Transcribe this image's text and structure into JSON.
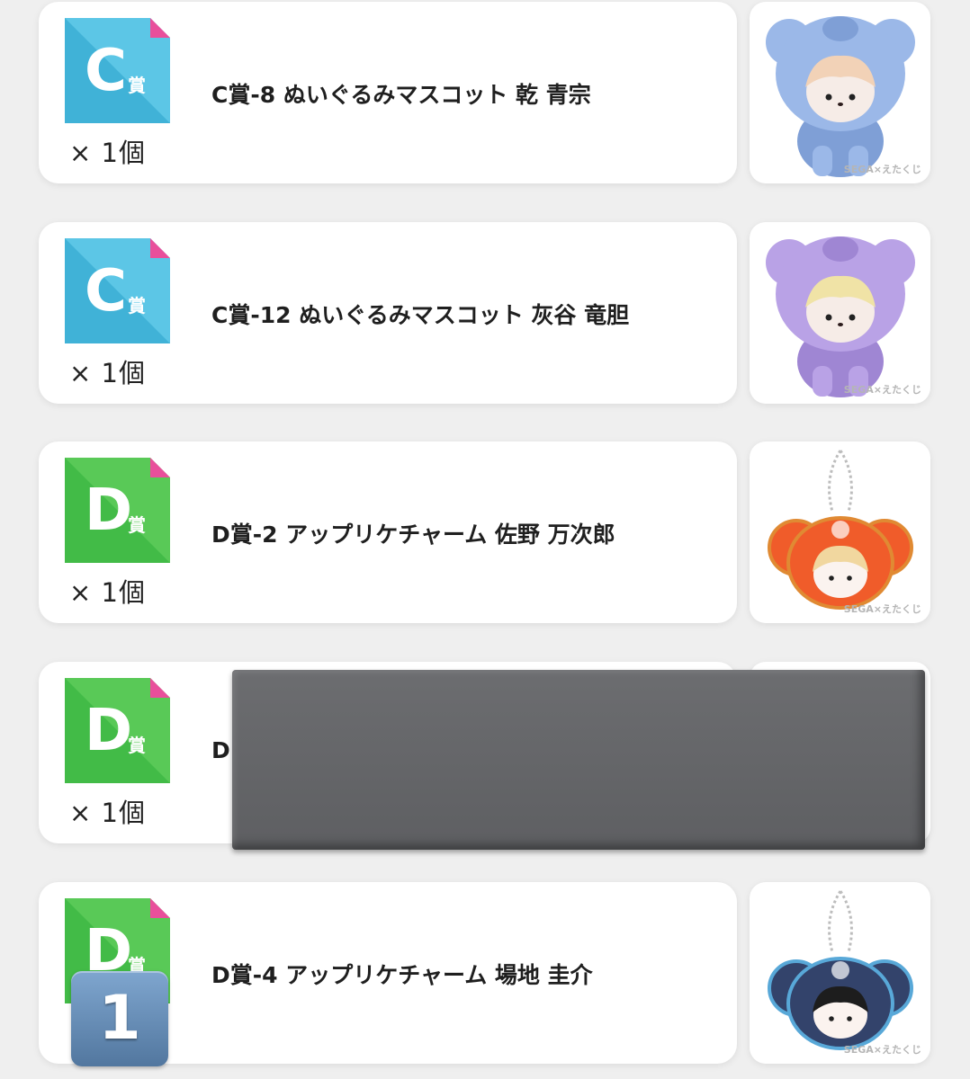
{
  "items": [
    {
      "grade_letter": "C",
      "grade_suffix": "賞",
      "grade_color": "#2aa3cb",
      "grade_color_light": "#5cc6e6",
      "name": "C賞-8 ぬいぐるみマスコット 乾 青宗",
      "quantity": "× 1個",
      "thumb_icon": "plush-mascot-blue-bear-icon",
      "watermark": "SEGA×えたくじ"
    },
    {
      "grade_letter": "C",
      "grade_suffix": "賞",
      "grade_color": "#2aa3cb",
      "grade_color_light": "#5cc6e6",
      "name": "C賞-12 ぬいぐるみマスコット 灰谷 竜胆",
      "quantity": "× 1個",
      "thumb_icon": "plush-mascot-purple-bear-icon",
      "watermark": "SEGA×えたくじ"
    },
    {
      "grade_letter": "D",
      "grade_suffix": "賞",
      "grade_color": "#2fae3a",
      "grade_color_light": "#59c957",
      "name": "D賞-2 アップリケチャーム 佐野 万次郎",
      "quantity": "× 1個",
      "thumb_icon": "applique-charm-orange-icon",
      "watermark": "SEGA×えたくじ"
    },
    {
      "grade_letter": "D",
      "grade_suffix": "賞",
      "grade_color": "#2fae3a",
      "grade_color_light": "#59c957",
      "name": "D",
      "quantity": "× 1個",
      "thumb_icon": "hidden-thumbnail-icon",
      "watermark": ""
    },
    {
      "grade_letter": "D",
      "grade_suffix": "賞",
      "grade_color": "#2fae3a",
      "grade_color_light": "#59c957",
      "name": "D賞-4 アップリケチャーム 場地 圭介",
      "quantity": "",
      "thumb_icon": "applique-charm-navy-icon",
      "watermark": "SEGA×えたくじ"
    }
  ],
  "overlay": {
    "counter_value": "1"
  }
}
